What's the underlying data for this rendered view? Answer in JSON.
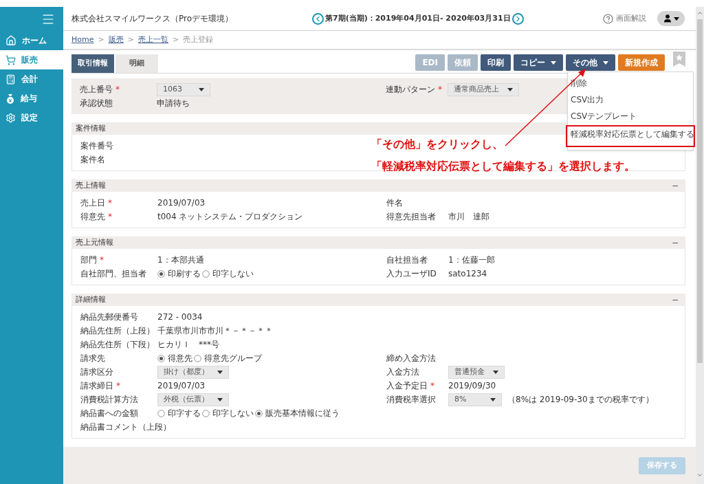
{
  "header": {
    "company": "株式会社スマイルワークス（Proデモ環境）",
    "period": "第7期(当期)：2019年04月01日- 2020年03月31日",
    "help": "画面解説"
  },
  "sidebar": {
    "items": [
      {
        "label": "ホーム",
        "selected": false
      },
      {
        "label": "販売",
        "selected": true
      },
      {
        "label": "会計",
        "selected": false
      },
      {
        "label": "給与",
        "selected": false
      },
      {
        "label": "設定",
        "selected": false
      }
    ]
  },
  "breadcrumb": {
    "separator": ">",
    "items": [
      {
        "label": "Home",
        "link": true
      },
      {
        "label": "販売",
        "link": true
      },
      {
        "label": "売上一覧",
        "link": true
      },
      {
        "label": "売上登録",
        "link": false
      }
    ]
  },
  "tabs": [
    {
      "label": "取引情報",
      "selected": true
    },
    {
      "label": "明細",
      "selected": false
    }
  ],
  "toolbar": [
    {
      "label": "EDI",
      "kind": "disabled",
      "dropdown": false
    },
    {
      "label": "依頼",
      "kind": "disabled",
      "dropdown": false
    },
    {
      "label": "印刷",
      "kind": "dark",
      "dropdown": false
    },
    {
      "label": "コピー",
      "kind": "dark",
      "dropdown": true
    },
    {
      "label": "その他",
      "kind": "dark",
      "dropdown": true
    },
    {
      "label": "新規作成",
      "kind": "accent",
      "dropdown": false
    }
  ],
  "menu": [
    {
      "label": "削除",
      "boxed": false
    },
    {
      "label": "CSV出力",
      "boxed": false
    },
    {
      "label": "CSVテンプレート",
      "boxed": false
    },
    {
      "label": "軽減税率対応伝票として編集する",
      "boxed": true
    }
  ],
  "summary": {
    "rows": [
      {
        "left": {
          "label": "売上番号",
          "mark": "*",
          "kind": "select",
          "value": "1063"
        },
        "right": {
          "label": "連動パターン",
          "mark": "*",
          "kind": "select",
          "value": "通常商品売上"
        }
      },
      {
        "left": {
          "label": "承認状態",
          "kind": "text",
          "value": "申請待ち"
        }
      }
    ]
  },
  "sections": [
    {
      "title": "案件情報",
      "rows": [
        {
          "left": {
            "label": "案件番号"
          }
        },
        {
          "left": {
            "label": "案件名"
          }
        }
      ]
    },
    {
      "title": "売上情報",
      "collapse": "−",
      "rows": [
        {
          "left": {
            "label": "売上日",
            "mark": "*",
            "kind": "date",
            "value": "2019/07/03"
          },
          "right": {
            "label": "件名"
          }
        },
        {
          "left": {
            "label": "得意先",
            "mark": "*",
            "kind": "text",
            "value": "t004 ネットシステム・プロダクション"
          },
          "right": {
            "label": "得意先担当者",
            "kind": "text",
            "value": "市川　達郎"
          }
        }
      ]
    },
    {
      "title": "売上元情報",
      "collapse": "−",
      "rows": [
        {
          "left": {
            "label": "部門",
            "mark": "*",
            "kind": "text",
            "value": "1：本部共通"
          },
          "right": {
            "label": "自社担当者",
            "kind": "text",
            "value": "1：佐藤一郎"
          }
        },
        {
          "left": {
            "label": "自社部門、担当者",
            "kind": "radio",
            "options": [
              {
                "label": "印刷する",
                "selected": true
              },
              {
                "label": "印字しない",
                "selected": false
              }
            ]
          },
          "right": {
            "label": "入力ユーザID",
            "kind": "text",
            "value": "sato1234"
          }
        }
      ]
    },
    {
      "title": "詳細情報",
      "collapse": "−",
      "rows": [
        {
          "left": {
            "label": "納品先郵便番号",
            "kind": "text",
            "value": "272  -  0034"
          }
        },
        {
          "left": {
            "label": "納品先住所（上段）",
            "kind": "text",
            "value": "千葉県市川市市川＊－＊－＊＊"
          }
        },
        {
          "left": {
            "label": "納品先住所（下段）",
            "kind": "text",
            "value": "ヒカリＩ　***号"
          }
        },
        {
          "left": {
            "label": "請求先",
            "kind": "radio",
            "options": [
              {
                "label": "得意先",
                "selected": true
              },
              {
                "label": "得意先グループ",
                "selected": false
              }
            ]
          },
          "right": {
            "label": "締め入金方法"
          }
        },
        {
          "left": {
            "label": "請求区分",
            "kind": "select",
            "value": "掛け（都度）"
          },
          "right": {
            "label": "入金方法",
            "kind": "select",
            "value": "普通預金"
          }
        },
        {
          "left": {
            "label": "請求締日",
            "mark": "*",
            "kind": "date",
            "value": "2019/07/03"
          },
          "right": {
            "label": "入金予定日",
            "mark": "*",
            "kind": "date",
            "value": "2019/09/30"
          }
        },
        {
          "left": {
            "label": "消費税計算方法",
            "kind": "select",
            "value": "外税（伝票）"
          },
          "right": {
            "label": "消費税率選択",
            "kind": "select",
            "value": "8%",
            "note": "（8%は 2019-09-30までの税率です）"
          }
        },
        {
          "left": {
            "label": "納品書への金額",
            "kind": "radio",
            "options": [
              {
                "label": "印字する",
                "selected": false
              },
              {
                "label": "印字しない",
                "selected": false
              },
              {
                "label": "販売基本情報に従う",
                "selected": true
              }
            ]
          }
        },
        {
          "left": {
            "label": "納品書コメント（上段）"
          }
        }
      ]
    }
  ],
  "footer": {
    "save": "保存する"
  },
  "annotation": {
    "lines": [
      "「その他」をクリックし、",
      "「軽減税率対応伝票として編集する」を選択します。"
    ]
  }
}
